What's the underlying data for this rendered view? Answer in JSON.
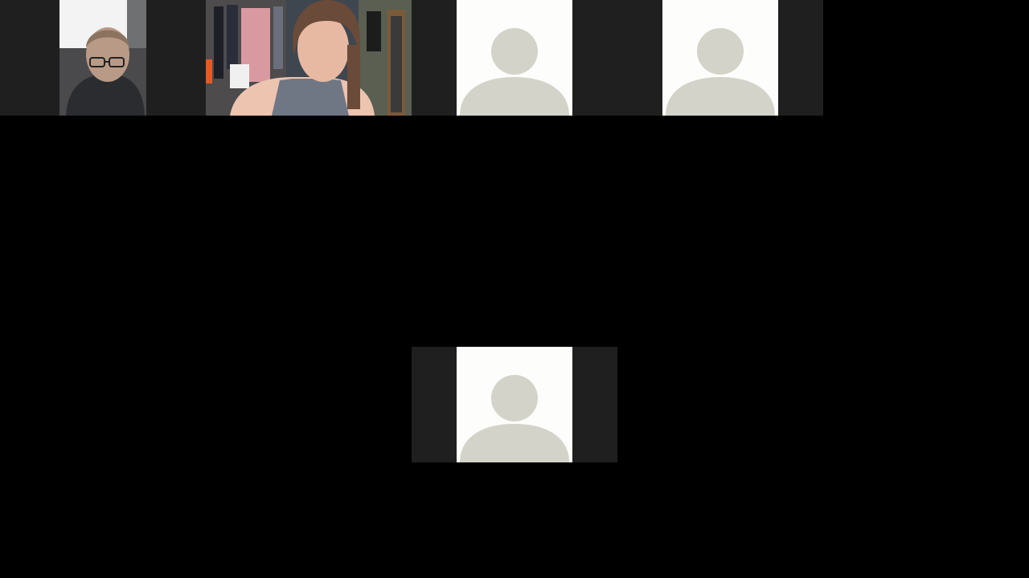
{
  "meeting": {
    "layout": "gallery-view",
    "background": "#000000",
    "tile_background": "#1f1f1f"
  },
  "participants": [
    {
      "kind": "video",
      "camera": "on",
      "icon": "video-feed"
    },
    {
      "kind": "video",
      "camera": "on",
      "icon": "video-feed"
    },
    {
      "kind": "avatar",
      "camera": "off",
      "icon": "user-silhouette-icon"
    },
    {
      "kind": "avatar",
      "camera": "off",
      "icon": "user-silhouette-icon"
    },
    {
      "kind": "avatar",
      "camera": "off",
      "icon": "user-silhouette-icon"
    }
  ],
  "colors": {
    "avatar_bg": "#fdfdfb",
    "avatar_fg": "#d3d3c9"
  }
}
